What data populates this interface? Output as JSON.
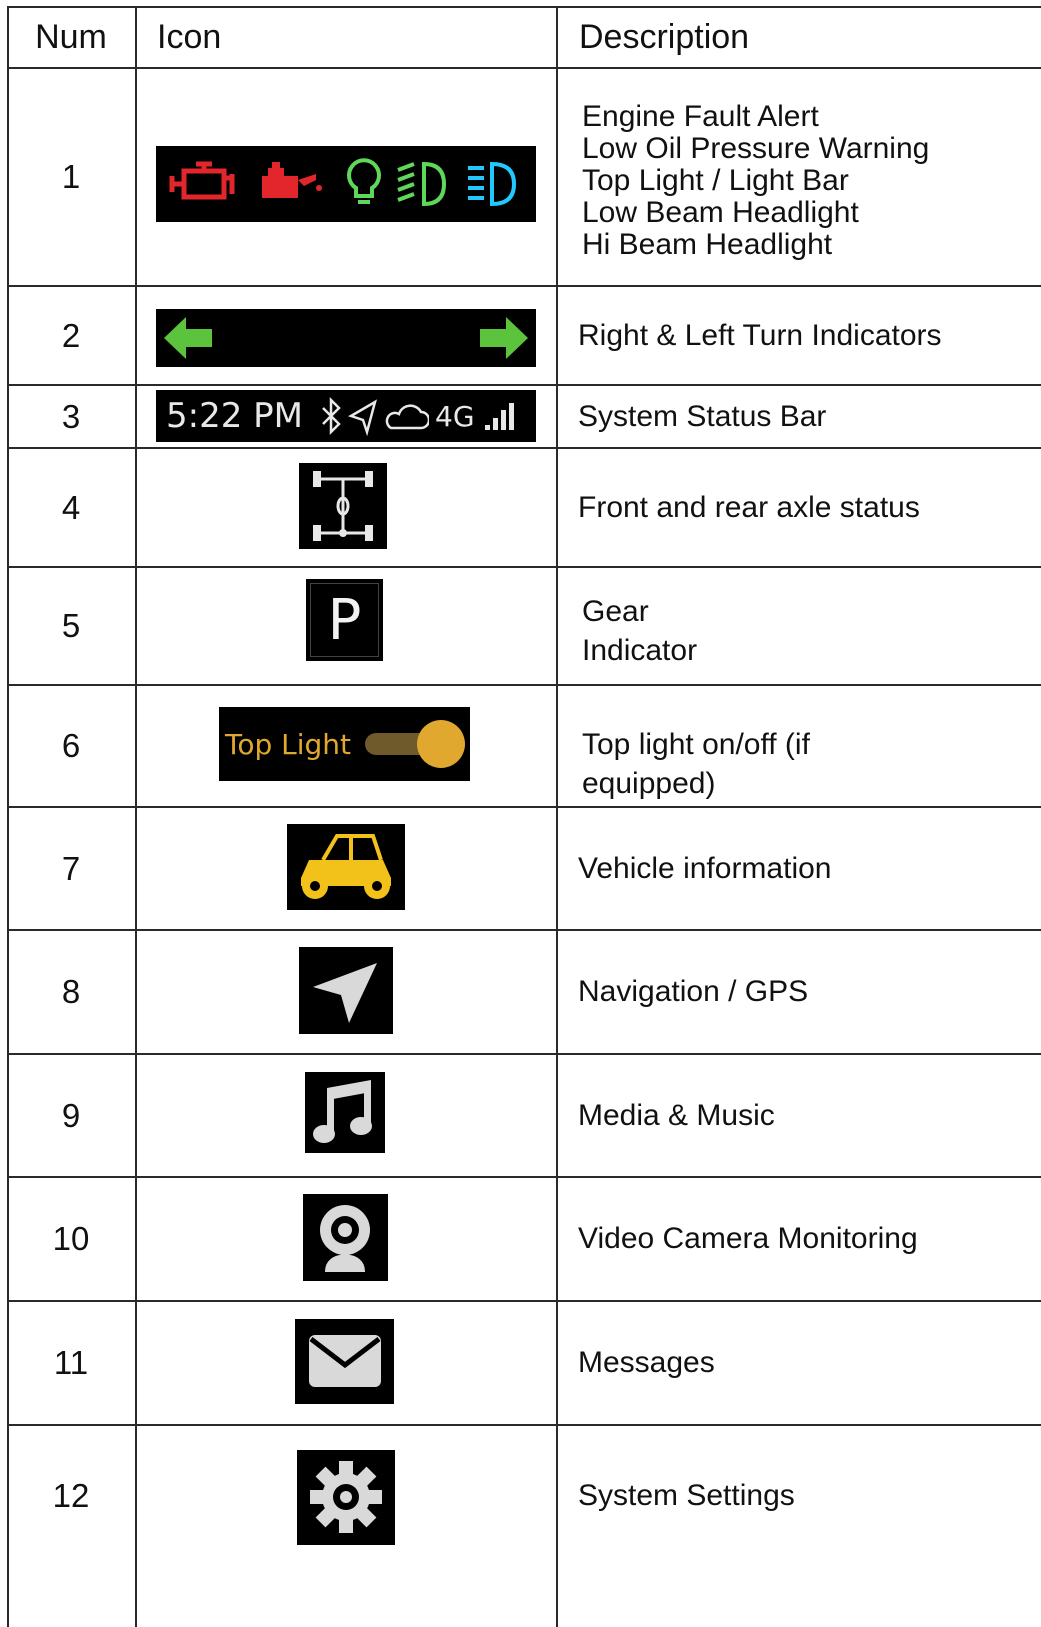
{
  "header": {
    "num": "Num",
    "icon": "Icon",
    "description": "Description"
  },
  "rows": [
    {
      "num": "1",
      "desc": [
        "Engine Fault Alert",
        "Low Oil Pressure Warning",
        "Top Light / Light Bar",
        "Low Beam Headlight",
        "Hi Beam Headlight"
      ],
      "icons": [
        "engine-fault-icon",
        "oil-pressure-icon",
        "top-light-icon",
        "low-beam-icon",
        "hi-beam-icon"
      ]
    },
    {
      "num": "2",
      "desc": [
        "Right & Left Turn Indicators"
      ],
      "icons": [
        "left-arrow-icon",
        "right-arrow-icon"
      ]
    },
    {
      "num": "3",
      "desc": [
        "System Status Bar"
      ],
      "status_bar": {
        "time": "5:22 PM",
        "network": "4G"
      },
      "icons": [
        "bluetooth-icon",
        "location-icon",
        "cloud-icon",
        "signal-icon"
      ]
    },
    {
      "num": "4",
      "desc": [
        "Front and rear axle status"
      ],
      "icons": [
        "axle-icon"
      ]
    },
    {
      "num": "5",
      "desc": [
        "Gear",
        "Indicator"
      ],
      "gear": "P"
    },
    {
      "num": "6",
      "desc": [
        "Top light on/off (if",
        "equipped)"
      ],
      "toggle": {
        "label": "Top Light",
        "on": true
      }
    },
    {
      "num": "7",
      "desc": [
        "Vehicle  information"
      ],
      "icons": [
        "utv-icon"
      ]
    },
    {
      "num": "8",
      "desc": [
        "Navigation / GPS"
      ],
      "icons": [
        "navigation-icon"
      ]
    },
    {
      "num": "9",
      "desc": [
        "Media & Music"
      ],
      "icons": [
        "music-icon"
      ]
    },
    {
      "num": "10",
      "desc": [
        "Video Camera Monitoring"
      ],
      "icons": [
        "camera-icon"
      ]
    },
    {
      "num": "11",
      "desc": [
        "Messages"
      ],
      "icons": [
        "envelope-icon"
      ]
    },
    {
      "num": "12",
      "desc": [
        "System Settings"
      ],
      "icons": [
        "gear-icon"
      ]
    }
  ],
  "colors": {
    "warning_red": "#e3262b",
    "light_green": "#5fd85a",
    "beam_cyan": "#22c9ff",
    "arrow_green": "#5cc33c",
    "toggle_gold": "#e0a82e",
    "utv_yellow": "#f2c21a",
    "icon_gray": "#d9d9d9"
  }
}
